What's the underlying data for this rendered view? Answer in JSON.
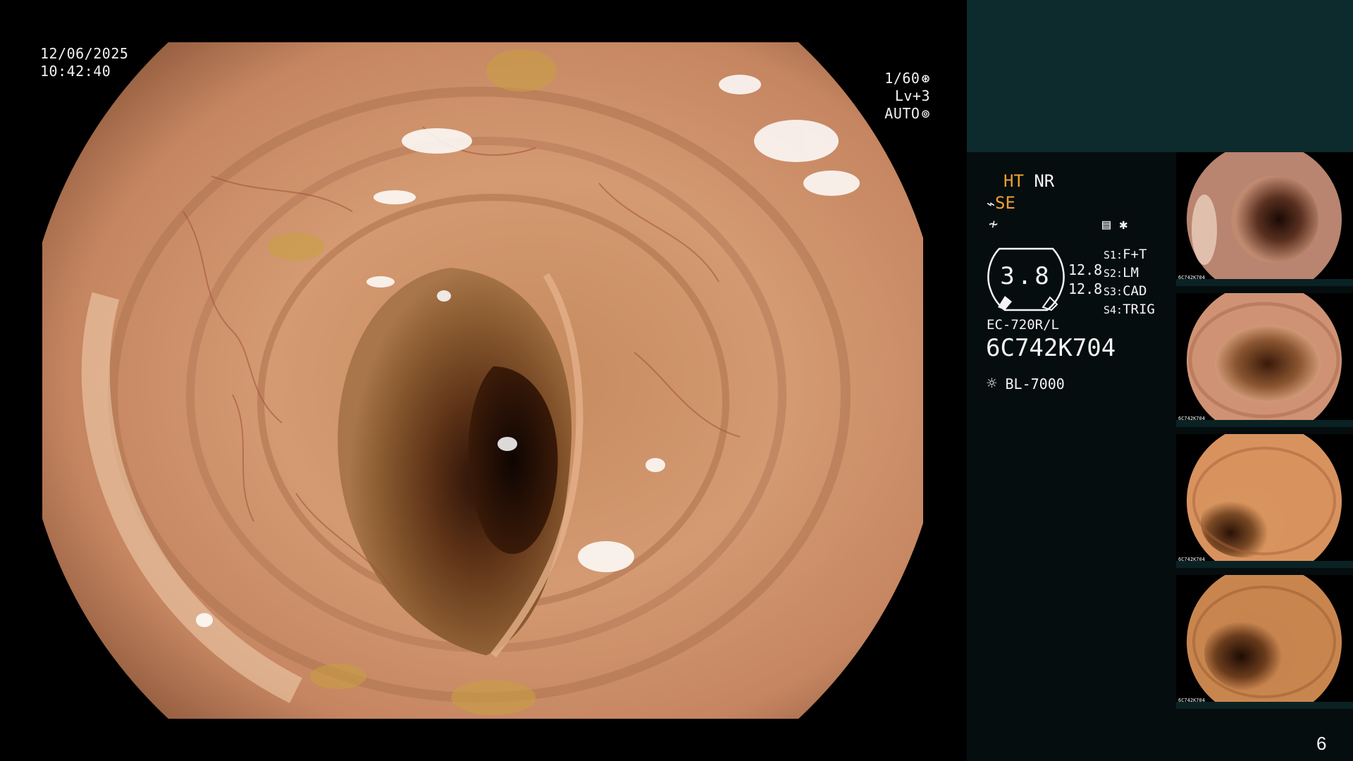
{
  "overlay": {
    "date": "12/06/2025",
    "time": "10:42:40",
    "shutter": "1/60",
    "level": "Lv+3",
    "mode": "AUTO"
  },
  "panel": {
    "ht": "HT",
    "nr": "NR",
    "se": "SE",
    "gauge_value": "3.8",
    "value_a": "12.8",
    "value_b": "12.8",
    "switches": [
      {
        "key": "S1:",
        "value": "F+T"
      },
      {
        "key": "S2:",
        "value": "LM"
      },
      {
        "key": "S3:",
        "value": "CAD"
      },
      {
        "key": "S4:",
        "value": "TRIG"
      }
    ],
    "scope_model": "EC-720R/L",
    "serial": "6C742K704",
    "light_source": "BL-7000",
    "page_number": "6"
  },
  "thumbnails": [
    {
      "serial": "6C742K704"
    },
    {
      "serial": "6C742K704"
    },
    {
      "serial": "6C742K704"
    },
    {
      "serial": "6C742K704"
    }
  ],
  "colors": {
    "panel_bg": "#050d0f",
    "panel_top_bg": "#0d2a2c",
    "accent_orange": "#f0a030"
  }
}
